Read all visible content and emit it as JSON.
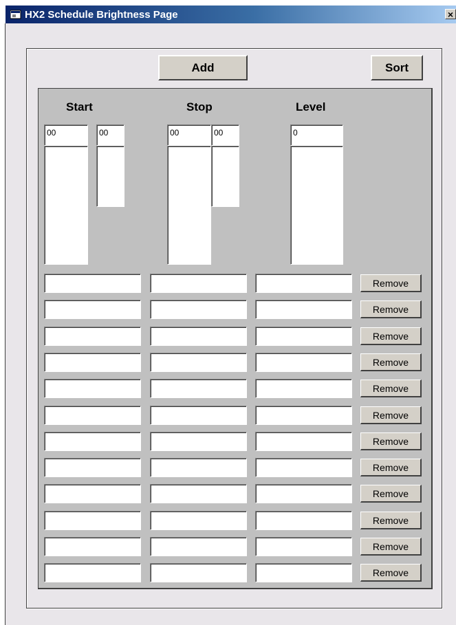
{
  "window": {
    "title": "HX2 Schedule Brightness Page",
    "close_symbol": "×",
    "app_icon": "window-app-icon"
  },
  "toolbar": {
    "add_label": "Add",
    "sort_label": "Sort"
  },
  "columns": {
    "start": "Start",
    "stop": "Stop",
    "level": "Level"
  },
  "selectors": {
    "start_hour": "00",
    "start_minute": "00",
    "stop_hour": "00",
    "stop_minute": "00",
    "level": "0"
  },
  "rows": [
    {
      "start": "",
      "stop": "",
      "level": "",
      "remove_label": "Remove"
    },
    {
      "start": "",
      "stop": "",
      "level": "",
      "remove_label": "Remove"
    },
    {
      "start": "",
      "stop": "",
      "level": "",
      "remove_label": "Remove"
    },
    {
      "start": "",
      "stop": "",
      "level": "",
      "remove_label": "Remove"
    },
    {
      "start": "",
      "stop": "",
      "level": "",
      "remove_label": "Remove"
    },
    {
      "start": "",
      "stop": "",
      "level": "",
      "remove_label": "Remove"
    },
    {
      "start": "",
      "stop": "",
      "level": "",
      "remove_label": "Remove"
    },
    {
      "start": "",
      "stop": "",
      "level": "",
      "remove_label": "Remove"
    },
    {
      "start": "",
      "stop": "",
      "level": "",
      "remove_label": "Remove"
    },
    {
      "start": "",
      "stop": "",
      "level": "",
      "remove_label": "Remove"
    },
    {
      "start": "",
      "stop": "",
      "level": "",
      "remove_label": "Remove"
    },
    {
      "start": "",
      "stop": "",
      "level": "",
      "remove_label": "Remove"
    }
  ]
}
